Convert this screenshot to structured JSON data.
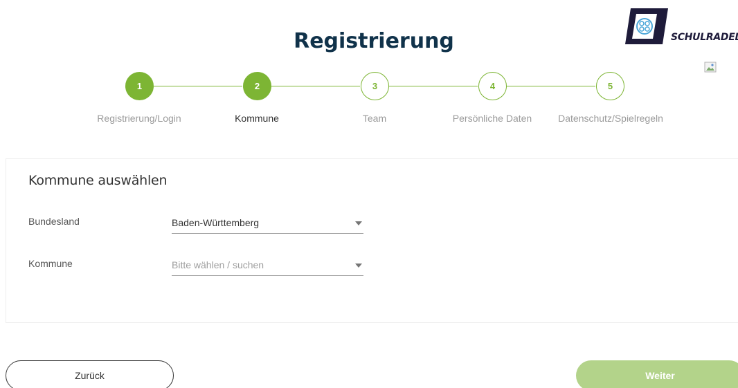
{
  "page": {
    "title": "Registrierung"
  },
  "logo": {
    "text": "SCHULRADELN"
  },
  "stepper": {
    "steps": [
      {
        "number": "1",
        "label": "Registrierung/Login",
        "state": "done"
      },
      {
        "number": "2",
        "label": "Kommune",
        "state": "current"
      },
      {
        "number": "3",
        "label": "Team",
        "state": "todo"
      },
      {
        "number": "4",
        "label": "Persönliche Daten",
        "state": "todo"
      },
      {
        "number": "5",
        "label": "Datenschutz/Spielregeln",
        "state": "todo"
      }
    ]
  },
  "form": {
    "title": "Kommune auswählen",
    "fields": [
      {
        "label": "Bundesland",
        "value": "Baden-Württemberg"
      },
      {
        "label": "Kommune",
        "placeholder": "Bitte wählen / suchen"
      }
    ]
  },
  "actions": {
    "back_label": "Zurück",
    "next_label": "Weiter"
  },
  "colors": {
    "accent": "#7db534",
    "accent_disabled": "#b3d38a",
    "title": "#10324a"
  }
}
